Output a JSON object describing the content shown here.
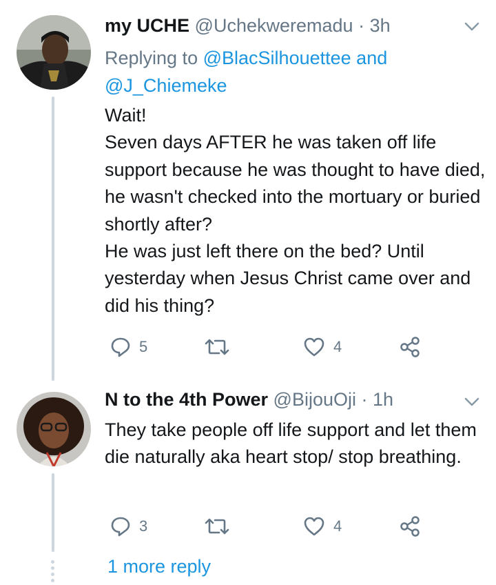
{
  "tweets": [
    {
      "display_name": "my UCHE",
      "handle": "@Uchekweremadu",
      "time": "· 3h",
      "replying_label": "Replying to",
      "replying_user1": "@BlacSilhouettee",
      "replying_and": "and",
      "replying_user2": "@J_Chiemeke",
      "text": "Wait!\nSeven days AFTER he was taken off life support because he was thought to have died, he wasn't checked into the mortuary or buried shortly after?\nHe was just left there on the bed? Until yesterday when Jesus Christ came over and did his thing?",
      "replies": "5",
      "retweets": "",
      "likes": "4"
    },
    {
      "display_name": "N to the 4th Power",
      "handle": "@BijouOji",
      "time": "· 1h",
      "text": "They take people off life support and let them die naturally aka heart stop/ stop breathing.",
      "replies": "3",
      "retweets": "",
      "likes": "4"
    }
  ],
  "more_replies": "1 more reply",
  "colors": {
    "accent": "#1b95e0",
    "muted": "#657786",
    "line": "#cdd6de"
  }
}
